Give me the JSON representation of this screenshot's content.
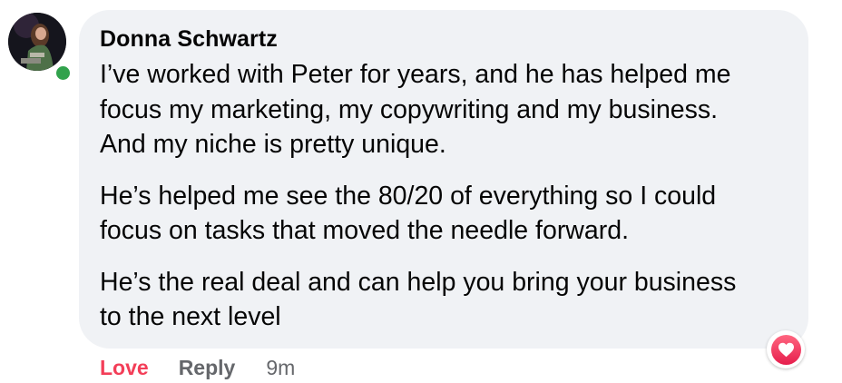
{
  "comment": {
    "author": "Donna Schwartz",
    "online": true,
    "paragraphs": [
      [
        "I’ve worked with Peter for years, and he has helped me",
        "focus my marketing, my copywriting and my business.",
        "And my niche is pretty unique."
      ],
      [
        "He’s helped me see the 80/20 of everything so I could",
        "focus on tasks that moved the needle forward."
      ],
      [
        "He’s the real deal and can help you bring your business",
        "to the next level"
      ]
    ],
    "reaction_icon": "heart-love-icon"
  },
  "actions": {
    "love_label": "Love",
    "reply_label": "Reply",
    "timestamp": "9m"
  },
  "colors": {
    "bubble": "#f0f2f5",
    "love": "#f33e58",
    "secondary_text": "#65676b",
    "online": "#31a24c"
  }
}
